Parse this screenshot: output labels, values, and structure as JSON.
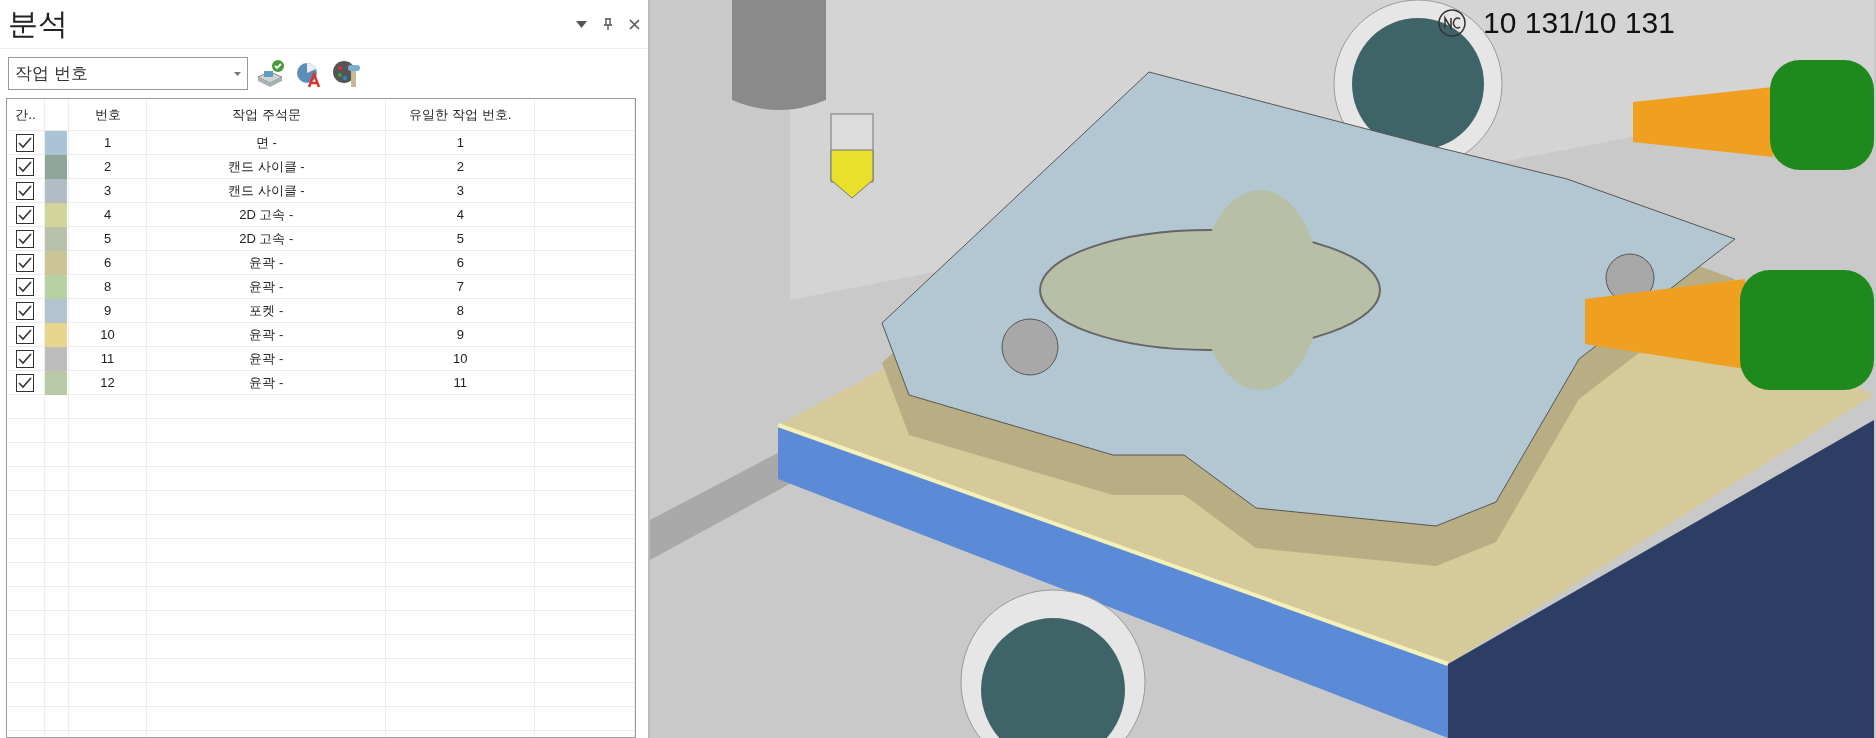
{
  "panel": {
    "title": "분석",
    "dropdown": {
      "value": "작업 번호"
    }
  },
  "table": {
    "columns": [
      "간..",
      "번호",
      "작업 주석문",
      "유일한 작업 번호."
    ],
    "rows": [
      {
        "checked": true,
        "color": "#aac4d6",
        "number": "1",
        "comment": "면 -",
        "unique": "1"
      },
      {
        "checked": true,
        "color": "#8ea59a",
        "number": "2",
        "comment": "캔드 사이클 -",
        "unique": "2"
      },
      {
        "checked": true,
        "color": "#b3bcc4",
        "number": "3",
        "comment": "캔드 사이클 -",
        "unique": "3"
      },
      {
        "checked": true,
        "color": "#d2d59a",
        "number": "4",
        "comment": "2D 고속 -",
        "unique": "4"
      },
      {
        "checked": true,
        "color": "#b7c1ac",
        "number": "5",
        "comment": "2D 고속 -",
        "unique": "5"
      },
      {
        "checked": true,
        "color": "#cbc596",
        "number": "6",
        "comment": "윤곽 -",
        "unique": "6"
      },
      {
        "checked": true,
        "color": "#b6d1a2",
        "number": "8",
        "comment": "윤곽 -",
        "unique": "7"
      },
      {
        "checked": true,
        "color": "#b1c4d0",
        "number": "9",
        "comment": "포켓 -",
        "unique": "8"
      },
      {
        "checked": true,
        "color": "#e8d68e",
        "number": "10",
        "comment": "윤곽 -",
        "unique": "9"
      },
      {
        "checked": true,
        "color": "#bdbdbd",
        "number": "11",
        "comment": "윤곽 -",
        "unique": "10"
      },
      {
        "checked": true,
        "color": "#b8c9a8",
        "number": "12",
        "comment": "윤곽 -",
        "unique": "11"
      }
    ]
  },
  "viewport": {
    "counter": "10 131/10 131"
  }
}
